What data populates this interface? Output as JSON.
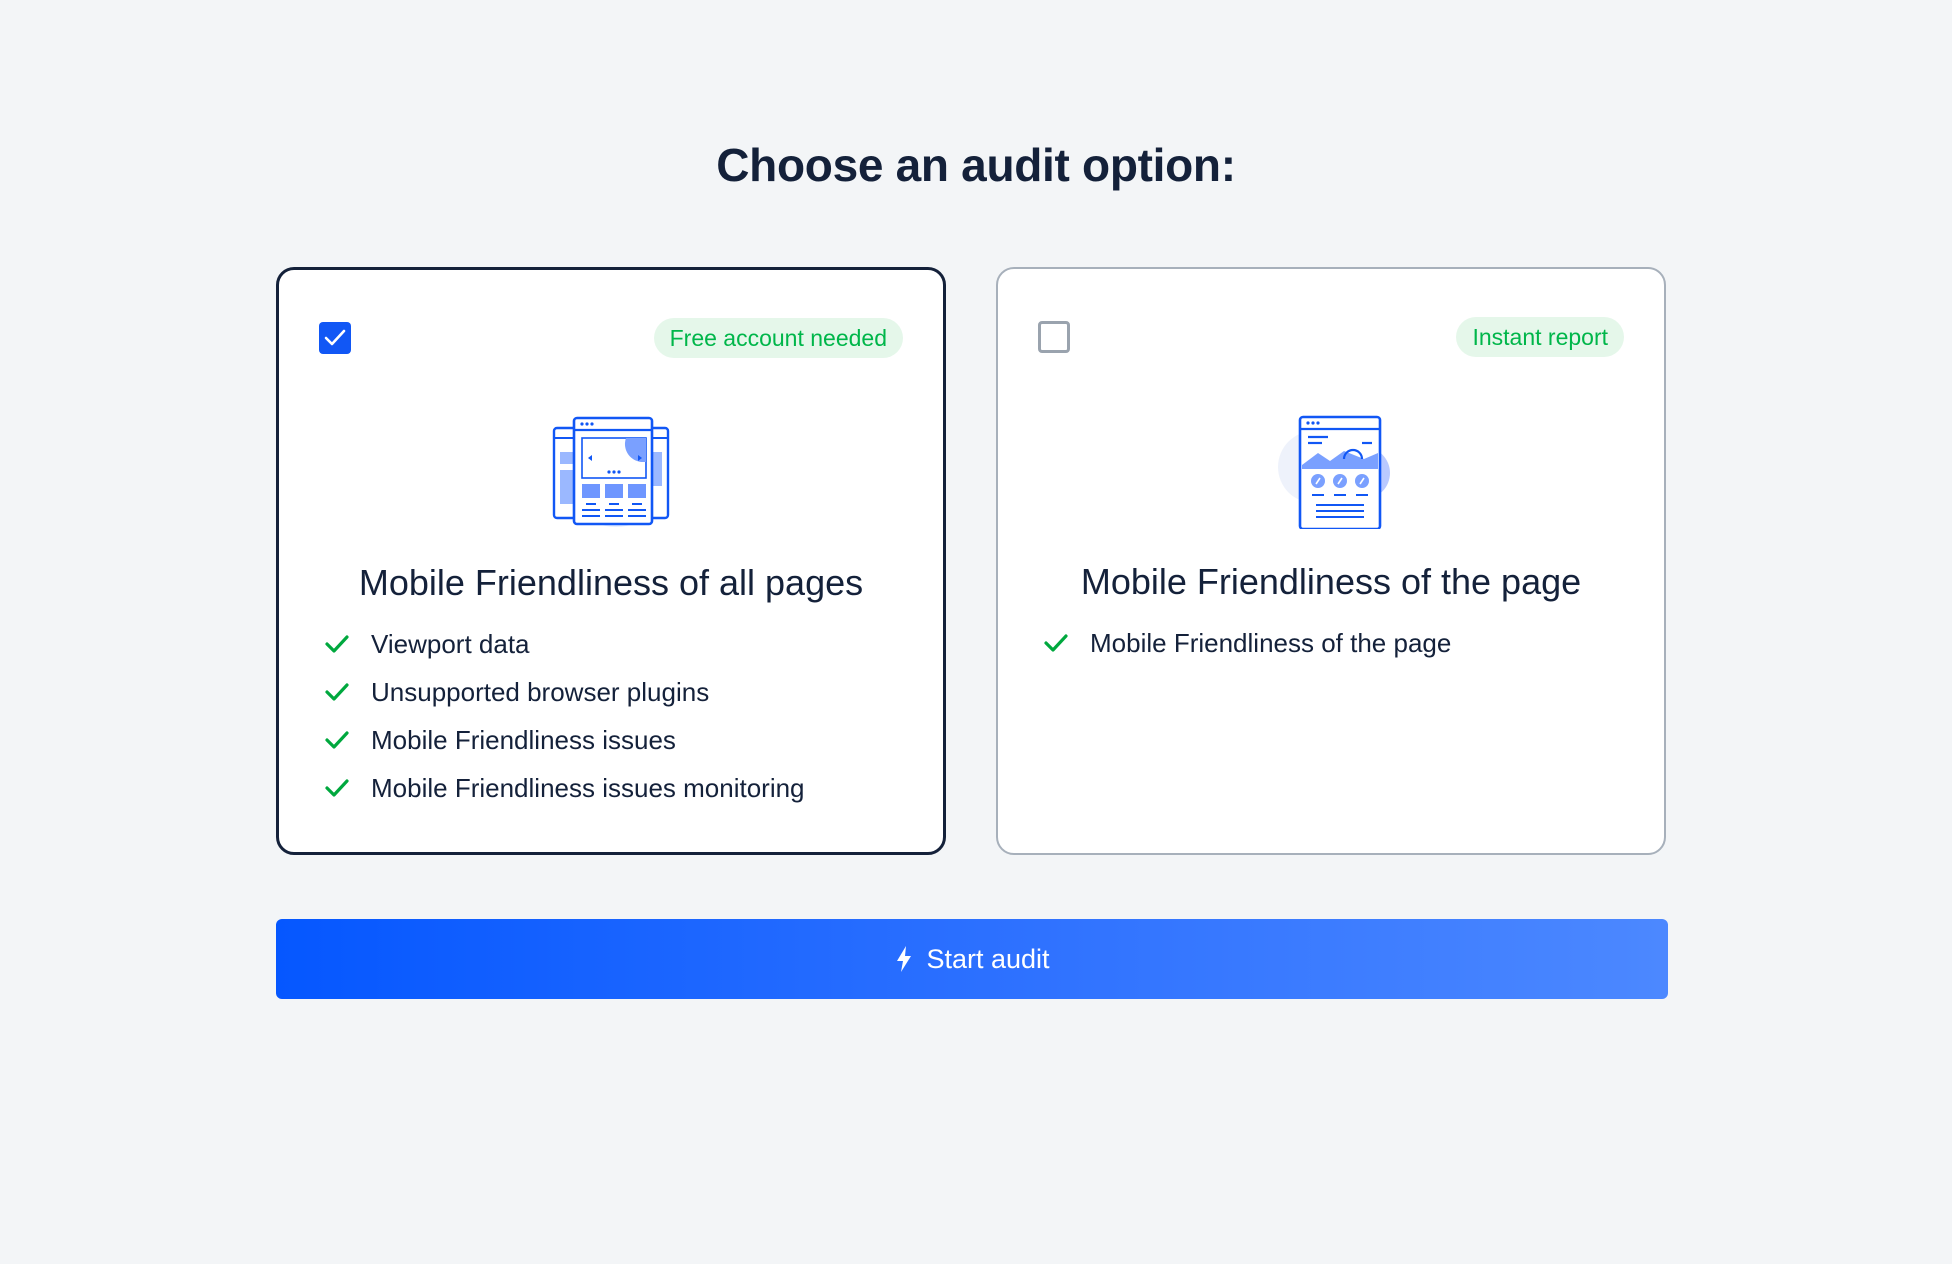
{
  "page": {
    "title": "Choose an audit option:"
  },
  "options": [
    {
      "selected": true,
      "badge": "Free account needed",
      "title": "Mobile Friendliness of all pages",
      "features": [
        "Viewport data",
        "Unsupported browser plugins",
        "Mobile Friendliness issues",
        "Mobile Friendliness issues monitoring"
      ],
      "icon": "multi-page-browser-icon"
    },
    {
      "selected": false,
      "badge": "Instant report",
      "title": "Mobile Friendliness of the page",
      "features": [
        "Mobile Friendliness of the page"
      ],
      "icon": "single-page-document-icon"
    }
  ],
  "start_button": {
    "label": "Start audit",
    "icon": "lightning-bolt-icon"
  },
  "colors": {
    "background": "#f3f5f7",
    "text_primary": "#14213a",
    "accent_blue": "#1157f5",
    "badge_bg": "#e5f7ea",
    "badge_text": "#00b64a",
    "check_green": "#00a83e"
  }
}
